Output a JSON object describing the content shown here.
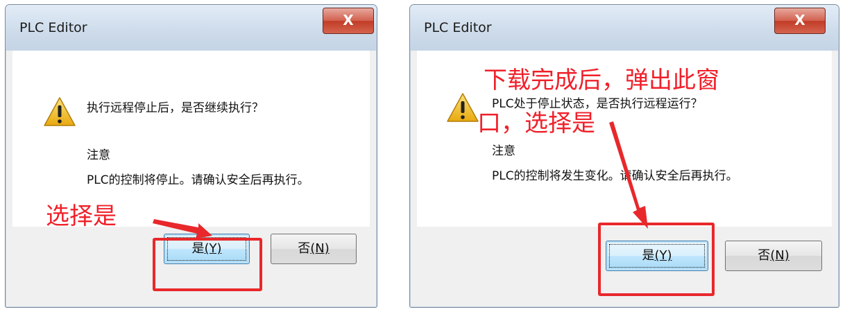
{
  "left_dialog": {
    "title": "PLC Editor",
    "close_label": "X",
    "question": "执行远程停止后，是否继续执行？",
    "note_heading": "注意",
    "note_text": "PLC的控制将停止。请确认安全后再执行。",
    "yes_label": "是",
    "yes_mnemonic": "(Y)",
    "no_label": "否",
    "no_mnemonic": "(N)",
    "annotation": "选择是"
  },
  "right_dialog": {
    "title": "PLC Editor",
    "close_label": "X",
    "question": "PLC处于停止状态，是否执行远程运行？",
    "note_heading": "注意",
    "note_text": "PLC的控制将发生变化。请确认安全后再执行。",
    "yes_label": "是",
    "yes_mnemonic": "(Y)",
    "no_label": "否",
    "no_mnemonic": "(N)",
    "annotation_line1": "下载完成后，弹出此窗",
    "annotation_line2": "口，选择是"
  },
  "colors": {
    "annotation_red": "#e8282b",
    "warning_yellow": "#f2c21b",
    "default_button_blue": "#3c7fb1"
  },
  "icons": [
    "warning-icon",
    "close-icon",
    "arrow-icon"
  ]
}
